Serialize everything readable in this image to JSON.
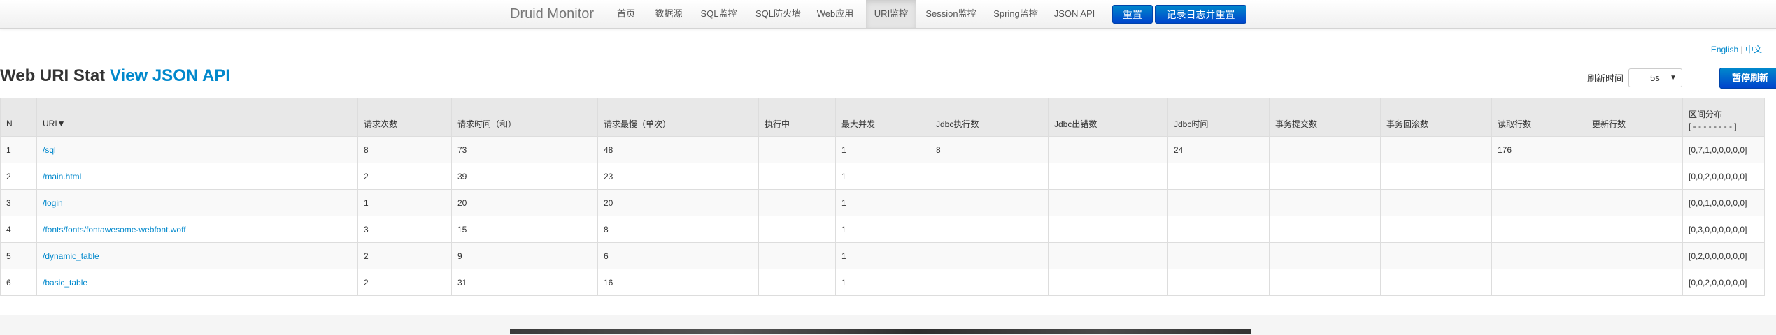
{
  "navbar": {
    "brand": "Druid Monitor",
    "items": [
      "首页",
      "数据源",
      "SQL监控",
      "SQL防火墙",
      "Web应用",
      "URI监控",
      "Session监控",
      "Spring监控",
      "JSON API"
    ],
    "active_item": "URI监控",
    "reset_button": "重置",
    "log_reset_button": "记录日志并重置"
  },
  "lang": {
    "english": "English",
    "separator": " | ",
    "chinese": "中文"
  },
  "header": {
    "title": "Web URI Stat",
    "api_link": "View JSON API",
    "refresh_label": "刷新时间",
    "refresh_value": "5s",
    "pause_button": "暂停刷新"
  },
  "table": {
    "headers": [
      "N",
      "URI▼",
      "请求次数",
      "请求时间（和）",
      "请求最慢（单次）",
      "执行中",
      "最大并发",
      "Jdbc执行数",
      "Jdbc出错数",
      "Jdbc时间",
      "事务提交数",
      "事务回滚数",
      "读取行数",
      "更新行数",
      "区间分布"
    ],
    "range_header_sub": "[ - - - - - - - - ]",
    "rows": [
      [
        "1",
        "/sql",
        "8",
        "73",
        "48",
        "",
        "1",
        "8",
        "",
        "24",
        "",
        "",
        "176",
        "",
        "[0,7,1,0,0,0,0,0]"
      ],
      [
        "2",
        "/main.html",
        "2",
        "39",
        "23",
        "",
        "1",
        "",
        "",
        "",
        "",
        "",
        "",
        "",
        "[0,0,2,0,0,0,0,0]"
      ],
      [
        "3",
        "/login",
        "1",
        "20",
        "20",
        "",
        "1",
        "",
        "",
        "",
        "",
        "",
        "",
        "",
        "[0,0,1,0,0,0,0,0]"
      ],
      [
        "4",
        "/fonts/fonts/fontawesome-webfont.woff",
        "3",
        "15",
        "8",
        "",
        "1",
        "",
        "",
        "",
        "",
        "",
        "",
        "",
        "[0,3,0,0,0,0,0,0]"
      ],
      [
        "5",
        "/dynamic_table",
        "2",
        "9",
        "6",
        "",
        "1",
        "",
        "",
        "",
        "",
        "",
        "",
        "",
        "[0,2,0,0,0,0,0,0]"
      ],
      [
        "6",
        "/basic_table",
        "2",
        "31",
        "16",
        "",
        "1",
        "",
        "",
        "",
        "",
        "",
        "",
        "",
        "[0,0,2,0,0,0,0,0]"
      ]
    ]
  },
  "colors": {
    "link": "#0088cc",
    "button_blue": "#0055cc",
    "header_bg": "#e8e8e8"
  }
}
